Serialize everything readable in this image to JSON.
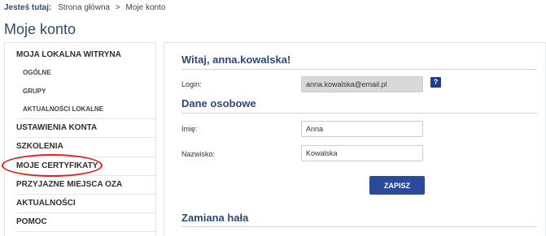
{
  "breadcrumb": {
    "label": "Jesteś tutaj:",
    "home": "Strona główna",
    "separator": ">",
    "current": "Moje konto"
  },
  "page_title": "Moje konto",
  "sidebar": {
    "items": [
      {
        "label": "MOJA LOKALNA WITRYNA"
      },
      {
        "label": "OGÓLNE"
      },
      {
        "label": "GRUPY"
      },
      {
        "label": "AKTUALNOŚCI LOKALNE"
      },
      {
        "label": "USTAWIENIA KONTA"
      },
      {
        "label": "SZKOLENIA"
      },
      {
        "label": "MOJE CERTYFIKATY"
      },
      {
        "label": "PRZYJAZNE MIEJSCA OZA"
      },
      {
        "label": "AKTUALNOŚCI"
      },
      {
        "label": "POMOC"
      }
    ],
    "highlighted_item": "MOJE CERTYFIKATY",
    "highlight_color": "#e02020"
  },
  "main": {
    "welcome_title": "Witaj, anna.kowalska!",
    "login_label": "Login:",
    "login_value": "anna.kowalska@email.pl",
    "help_icon_text": "?",
    "personal_section_title": "Dane osobowe",
    "first_name_label": "Imię:",
    "first_name_value": "Anna",
    "last_name_label": "Nazwisko:",
    "last_name_value": "Kowalska",
    "save_label": "ZAPISZ",
    "password_section_title": "Zamiana hała"
  },
  "colors": {
    "accent": "#2c4a78",
    "button": "#2c4a9a",
    "help_button": "#1e3f8f"
  }
}
